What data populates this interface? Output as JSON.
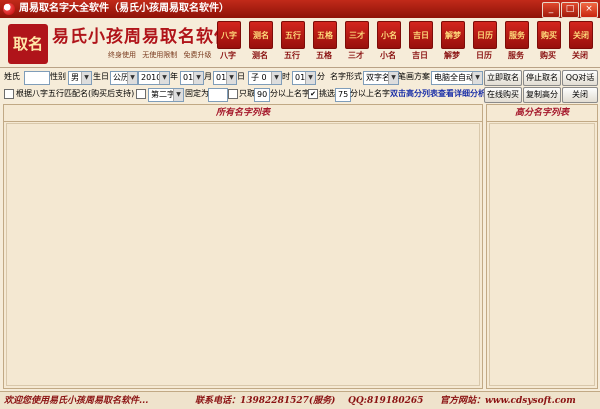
{
  "window": {
    "title": "周易取名字大全软件（易氏小孩周易取名软件）",
    "min": "_",
    "max": "□",
    "close": "×"
  },
  "banner": {
    "logo": "取名",
    "brand": "易氏小孩周易取名软件",
    "slogan": [
      "终身使用",
      "无使用限制",
      "免费升级"
    ]
  },
  "toolbar": [
    {
      "icon": "八字",
      "label": "八字"
    },
    {
      "icon": "测名",
      "label": "测名"
    },
    {
      "icon": "五行",
      "label": "五行"
    },
    {
      "icon": "五格",
      "label": "五格"
    },
    {
      "icon": "三才",
      "label": "三才"
    },
    {
      "icon": "小名",
      "label": "小名"
    },
    {
      "icon": "吉日",
      "label": "吉日"
    },
    {
      "icon": "解梦",
      "label": "解梦"
    },
    {
      "icon": "日历",
      "label": "日历"
    },
    {
      "icon": "服务",
      "label": "服务"
    },
    {
      "icon": "购买",
      "label": "购买"
    },
    {
      "icon": "关闭",
      "label": "关闭"
    }
  ],
  "form": {
    "surname_label": "姓氏",
    "surname_value": "",
    "gender_label": "性别",
    "gender_value": "男",
    "birth_label": "生日",
    "calendar_value": "公历",
    "year_value": "2010",
    "year_unit": "年",
    "month_value": "01",
    "month_unit": "月",
    "day_value": "01",
    "day_unit": "日",
    "hour_value": "子 0",
    "hour_unit": "时",
    "minute_value": "01",
    "minute_unit": "分",
    "name_form_label": "名字形式",
    "name_form_value": "双字名",
    "stroke_label": "笔画方案",
    "stroke_value": "电脑全自动",
    "btn_start": "立即取名",
    "btn_stop": "停止取名",
    "btn_qq": "QQ对话"
  },
  "options": {
    "bazi_label": "根据八字五行匹配名(购买后支持)",
    "second_char_value": "第二字",
    "fixed_label": "固定为",
    "fixed_value": "",
    "only_label": "只取",
    "only_value": "90",
    "only_suffix": "分以上名字",
    "pick_label": "挑选",
    "pick_value": "75",
    "pick_suffix": "分以上名字",
    "hint": "双击高分列表查看详细分析",
    "btn_online": "在线购买",
    "btn_copy": "复制高分",
    "btn_close": "关闭"
  },
  "panels": {
    "all_names": "所有名字列表",
    "high_names": "高分名字列表"
  },
  "status": {
    "welcome": "欢迎您使用易氏小孩周易取名软件...",
    "phone": "联系电话：13982281527(服务)",
    "qq": "QQ:819180265",
    "site": "官方网站：www.cdsysoft.com"
  }
}
